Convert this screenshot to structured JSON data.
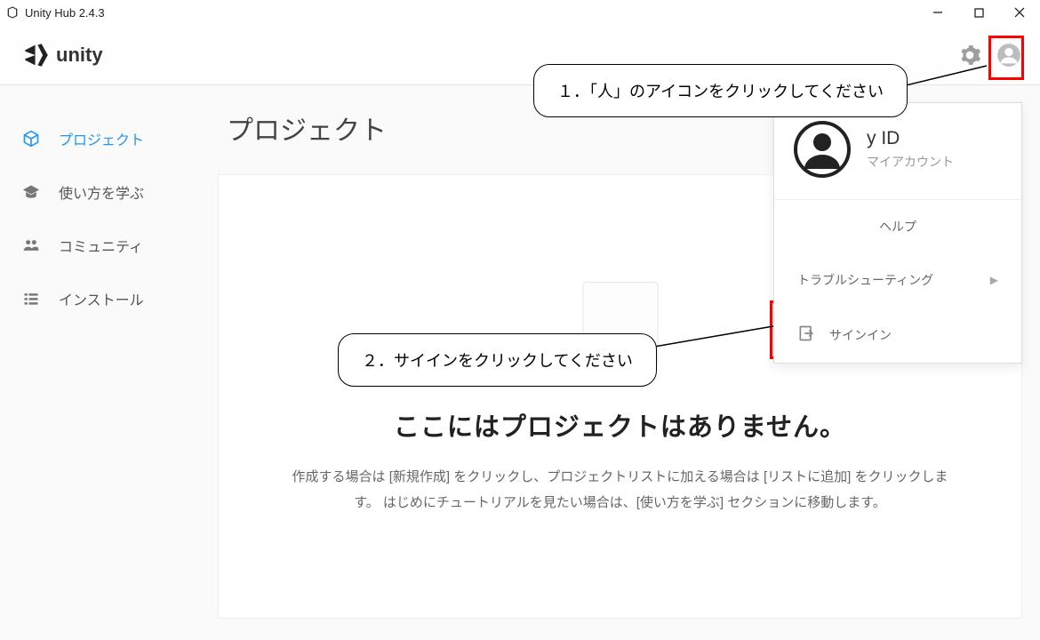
{
  "window": {
    "title": "Unity Hub 2.4.3"
  },
  "header": {
    "brand": "unity"
  },
  "sidebar": {
    "items": [
      {
        "label": "プロジェクト"
      },
      {
        "label": "使い方を学ぶ"
      },
      {
        "label": "コミュニティ"
      },
      {
        "label": "インストール"
      }
    ]
  },
  "main": {
    "title": "プロジェクト",
    "empty_heading": "ここにはプロジェクトはありません。",
    "empty_desc": "作成する場合は [新規作成] をクリックし、プロジェクトリストに加える場合は [リストに追加] をクリックします。 はじめにチュートリアルを見たい場合は、[使い方を学ぶ] セクションに移動します。"
  },
  "dropdown": {
    "id_title_suffix": "y ID",
    "sub": "マイアカウント",
    "help": "ヘルプ",
    "troubleshoot": "トラブルシューティング",
    "signin": "サインイン"
  },
  "callouts": {
    "c1": "１．「人」のアイコンをクリックしてください",
    "c2": "２．サイインをクリックしてください"
  }
}
